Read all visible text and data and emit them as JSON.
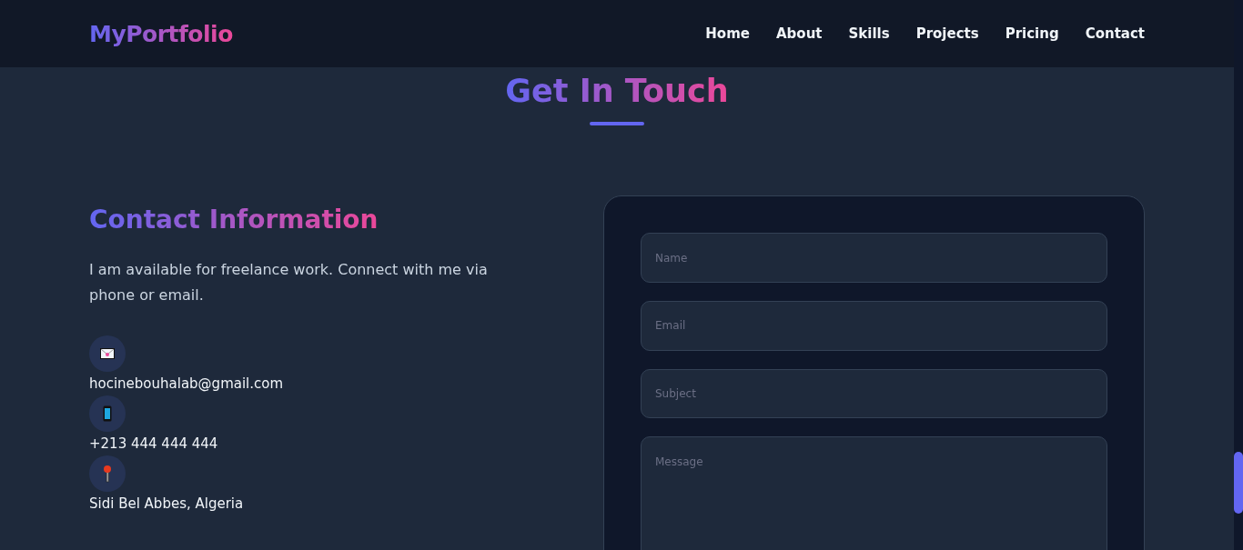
{
  "navbar": {
    "logo": "MyPortfolio",
    "links": [
      {
        "label": "Home"
      },
      {
        "label": "About"
      },
      {
        "label": "Skills"
      },
      {
        "label": "Projects"
      },
      {
        "label": "Pricing"
      },
      {
        "label": "Contact"
      }
    ]
  },
  "section": {
    "title": "Get In Touch"
  },
  "contact_info": {
    "heading": "Contact Information",
    "description": "I am available for freelance work. Connect with me via phone or email.",
    "items": [
      {
        "kind": "email",
        "text": "hocinebouhalab@gmail.com"
      },
      {
        "kind": "phone",
        "text": "+213 444 444 444"
      },
      {
        "kind": "location",
        "text": "Sidi Bel Abbes, Algeria"
      }
    ]
  },
  "form": {
    "fields": [
      {
        "kind": "input",
        "placeholder": "Name"
      },
      {
        "kind": "input",
        "placeholder": "Email"
      },
      {
        "kind": "input",
        "placeholder": "Subject"
      },
      {
        "kind": "textarea",
        "placeholder": "Message"
      }
    ]
  }
}
